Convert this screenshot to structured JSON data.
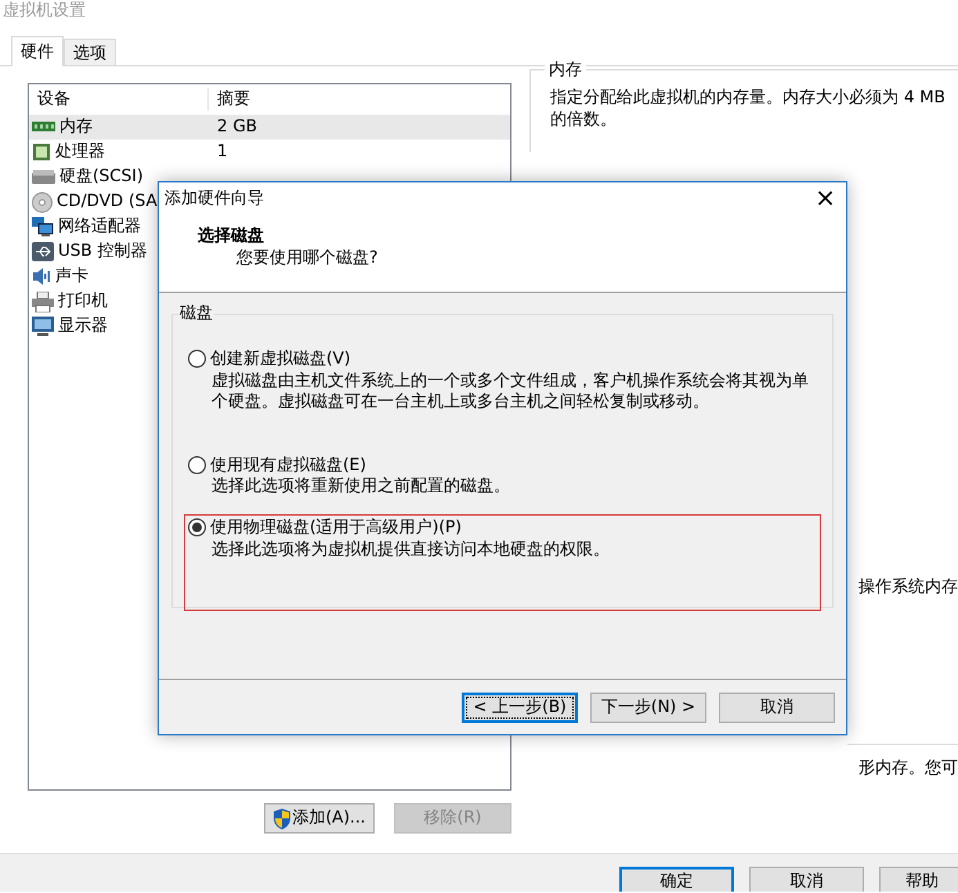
{
  "window": {
    "title": "虚拟机设置"
  },
  "tabs": [
    {
      "label": "硬件",
      "selected": true
    },
    {
      "label": "选项",
      "selected": false
    }
  ],
  "device_list": {
    "columns": [
      "设备",
      "摘要"
    ],
    "rows": [
      {
        "kind": "memory",
        "device": "内存",
        "summary": "2 GB",
        "selected": true
      },
      {
        "kind": "cpu",
        "device": "处理器",
        "summary": "1",
        "selected": false
      },
      {
        "kind": "disk",
        "device": "硬盘(SCSI)",
        "selected": false
      },
      {
        "kind": "cd",
        "device": "CD/DVD (SA",
        "selected": false
      },
      {
        "kind": "network",
        "device": "网络适配器",
        "selected": false
      },
      {
        "kind": "usb",
        "device": "USB 控制器",
        "selected": false
      },
      {
        "kind": "sound",
        "device": "声卡",
        "selected": false
      },
      {
        "kind": "printer",
        "device": "打印机",
        "selected": false
      },
      {
        "kind": "display",
        "device": "显示器",
        "selected": false
      }
    ]
  },
  "list_buttons": [
    {
      "label": "添加(A)...",
      "shield": true,
      "disabled": false
    },
    {
      "label": "移除(R)",
      "shield": false,
      "disabled": true
    }
  ],
  "memory_panel": {
    "title": "内存",
    "description": "指定分配给此虚拟机的内存量。内存大小必须为 4 MB 的倍数。",
    "fragment_1": "操作系统内存",
    "fragment_2": "形内存。您可"
  },
  "dialog": {
    "title": "添加硬件向导",
    "close": "×",
    "heading": "选择磁盘",
    "subheading": "您要使用哪个磁盘?",
    "group_title": "磁盘",
    "options": [
      {
        "label": "创建新虚拟磁盘(V)",
        "description": "虚拟磁盘由主机文件系统上的一个或多个文件组成，客户机操作系统会将其视为单个硬盘。虚拟磁盘可在一台主机上或多台主机之间轻松复制或移动。",
        "selected": false,
        "highlighted": false
      },
      {
        "label": "使用现有虚拟磁盘(E)",
        "description": "选择此选项将重新使用之前配置的磁盘。",
        "selected": false,
        "highlighted": false
      },
      {
        "label": "使用物理磁盘(适用于高级用户)(P)",
        "description": "选择此选项将为虚拟机提供直接访问本地硬盘的权限。",
        "selected": true,
        "highlighted": true
      }
    ],
    "buttons": [
      {
        "label": "< 上一步(B)",
        "focused": true
      },
      {
        "label": "下一步(N) >",
        "focused": false
      },
      {
        "label": "取消",
        "focused": false
      }
    ]
  },
  "footer_buttons": [
    {
      "label": "确定",
      "default": true
    },
    {
      "label": "取消",
      "default": false
    },
    {
      "label": "帮助",
      "default": false
    }
  ]
}
